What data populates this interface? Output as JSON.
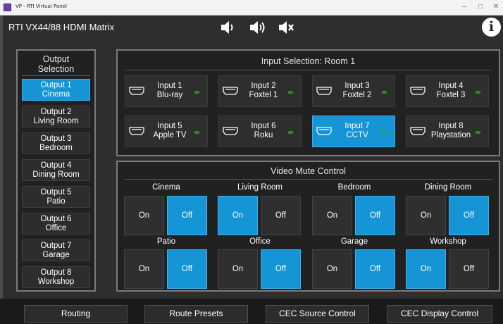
{
  "window": {
    "title": "VP - RTI Virtual Panel",
    "controls": [
      "–",
      "□",
      "✕"
    ]
  },
  "app": {
    "title": "RTI VX44/88 HDMI Matrix",
    "volume_icons": [
      "volume-down-icon",
      "volume-up-icon",
      "mute-icon"
    ],
    "info_label": "i"
  },
  "sidebar": {
    "title_line1": "Output",
    "title_line2": "Selection",
    "outputs": [
      {
        "line1": "Output 1",
        "line2": "Cinema",
        "active": true
      },
      {
        "line1": "Output 2",
        "line2": "Living Room",
        "active": false
      },
      {
        "line1": "Output 3",
        "line2": "Bedroom",
        "active": false
      },
      {
        "line1": "Output 4",
        "line2": "Dining Room",
        "active": false
      },
      {
        "line1": "Output 5",
        "line2": "Patio",
        "active": false
      },
      {
        "line1": "Output 6",
        "line2": "Office",
        "active": false
      },
      {
        "line1": "Output 7",
        "line2": "Garage",
        "active": false
      },
      {
        "line1": "Output 8",
        "line2": "Workshop",
        "active": false
      }
    ]
  },
  "input_selection": {
    "title": "Input Selection: Room 1",
    "inputs": [
      {
        "line1": "Input 1",
        "line2": "Blu-ray",
        "active": false
      },
      {
        "line1": "Input 2",
        "line2": "Foxtel 1",
        "active": false
      },
      {
        "line1": "Input 3",
        "line2": "Foxtel 2",
        "active": false
      },
      {
        "line1": "Input 4",
        "line2": "Foxtel 3",
        "active": false
      },
      {
        "line1": "Input 5",
        "line2": "Apple TV",
        "active": false
      },
      {
        "line1": "Input 6",
        "line2": "Roku",
        "active": false
      },
      {
        "line1": "Input 7",
        "line2": "CCTV",
        "active": true
      },
      {
        "line1": "Input 8",
        "line2": "Playstation",
        "active": false
      }
    ]
  },
  "video_mute": {
    "title": "Video Mute Control",
    "on_label": "On",
    "off_label": "Off",
    "rooms": [
      {
        "name": "Cinema",
        "state": "Off"
      },
      {
        "name": "Living Room",
        "state": "On"
      },
      {
        "name": "Bedroom",
        "state": "Off"
      },
      {
        "name": "Dining Room",
        "state": "Off"
      },
      {
        "name": "Patio",
        "state": "Off"
      },
      {
        "name": "Office",
        "state": "Off"
      },
      {
        "name": "Garage",
        "state": "Off"
      },
      {
        "name": "Workshop",
        "state": "On"
      }
    ]
  },
  "bottom_tabs": [
    "Routing",
    "Route Presets",
    "CEC Source Control",
    "CEC Display Control"
  ],
  "colors": {
    "accent": "#1594d6",
    "led": "#2fae24",
    "background": "#2e2e2e"
  }
}
